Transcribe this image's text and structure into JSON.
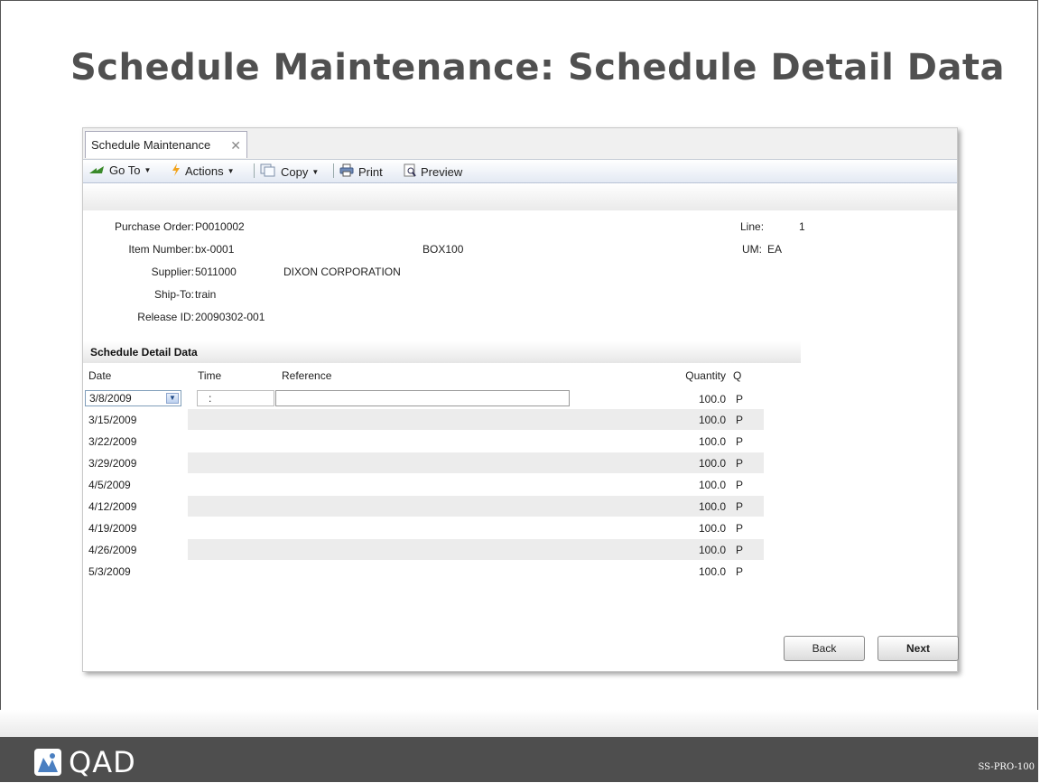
{
  "slide": {
    "title": "Schedule Maintenance: Schedule Detail Data"
  },
  "window": {
    "tab_label": "Schedule Maintenance",
    "tab_close": "✕",
    "toolbar": {
      "goto": "Go To",
      "actions": "Actions",
      "copy": "Copy",
      "print": "Print",
      "preview": "Preview"
    }
  },
  "header": {
    "purchase_order_label": "Purchase Order:",
    "purchase_order": "P0010002",
    "item_number_label": "Item Number:",
    "item_number": "bx-0001",
    "item_desc": "BOX100",
    "supplier_label": "Supplier:",
    "supplier": "5011000",
    "supplier_name": "DIXON CORPORATION",
    "ship_to_label": "Ship-To:",
    "ship_to": "train",
    "release_id_label": "Release ID:",
    "release_id": "20090302-001",
    "line_label": "Line:",
    "line": "1",
    "um_label": "UM:",
    "um": "EA"
  },
  "detail": {
    "section_title": "Schedule Detail Data",
    "columns": {
      "date": "Date",
      "time": "Time",
      "reference": "Reference",
      "quantity": "Quantity",
      "q": "Q"
    },
    "first_row": {
      "date": "3/8/2009",
      "time": ":",
      "quantity": "100.0",
      "q": "P"
    },
    "rows": [
      {
        "date": "3/15/2009",
        "quantity": "100.0",
        "q": "P"
      },
      {
        "date": "3/22/2009",
        "quantity": "100.0",
        "q": "P"
      },
      {
        "date": "3/29/2009",
        "quantity": "100.0",
        "q": "P"
      },
      {
        "date": "4/5/2009",
        "quantity": "100.0",
        "q": "P"
      },
      {
        "date": "4/12/2009",
        "quantity": "100.0",
        "q": "P"
      },
      {
        "date": "4/19/2009",
        "quantity": "100.0",
        "q": "P"
      },
      {
        "date": "4/26/2009",
        "quantity": "100.0",
        "q": "P"
      },
      {
        "date": "5/3/2009",
        "quantity": "100.0",
        "q": "P"
      }
    ]
  },
  "buttons": {
    "back": "Back",
    "next": "Next"
  },
  "footer": {
    "logo_text": "QAD",
    "code": "SS-PRO-100"
  }
}
